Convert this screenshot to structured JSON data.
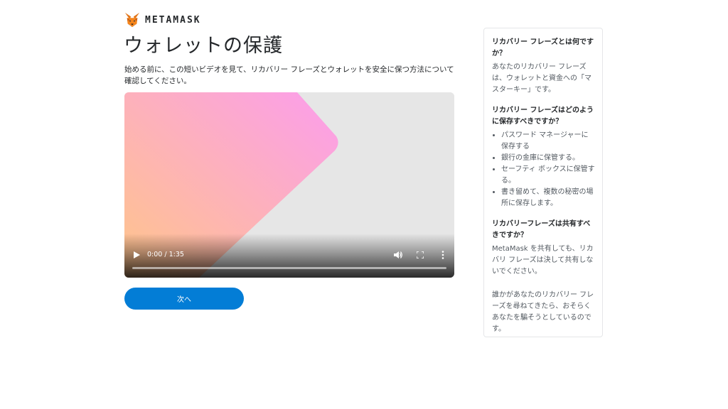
{
  "brand": {
    "name": "METAMASK",
    "logo_icon": "metamask-fox-icon"
  },
  "page": {
    "title": "ウォレットの保護",
    "intro": "始める前に、この短いビデオを見て、リカバリー フレーズとウォレットを安全に保つ方法について確認してください。"
  },
  "video": {
    "time": "0:00 / 1:35",
    "progress": 0,
    "icons": [
      "play-icon",
      "volume-icon",
      "fullscreen-icon",
      "more-options-icon"
    ]
  },
  "actions": {
    "next_label": "次へ"
  },
  "sidebar": {
    "q1": "リカバリー フレーズとは何ですか？",
    "a1": "あなたのリカバリー フレーズは、ウォレットと資金への「マスターキー」です。",
    "q2": "リカバリー フレーズはどのように保存すべきですか？",
    "tips": [
      "パスワード マネージャーに保存する",
      "銀行の金庫に保管する。",
      "セーフティ ボックスに保管する。",
      "書き留めて、複数の秘密の場所に保存します。"
    ],
    "q3": "リカバリーフレーズは共有すべきですか？",
    "a3": "MetaMask を共有しても、リカバリ フレーズは決して共有しないでください。",
    "a4": "誰かがあなたのリカバリー フレーズを尋ねてきたら、おそらくあなたを騙そうとしているのです。"
  },
  "colors": {
    "primary": "#037dd6",
    "text": "#24272a",
    "muted_text": "#535a61",
    "video_bg": "#e6e6e6",
    "gradient_pink": "#fb9ded",
    "gradient_orange": "#ffc58a",
    "fox_orange": "#e2761b"
  }
}
